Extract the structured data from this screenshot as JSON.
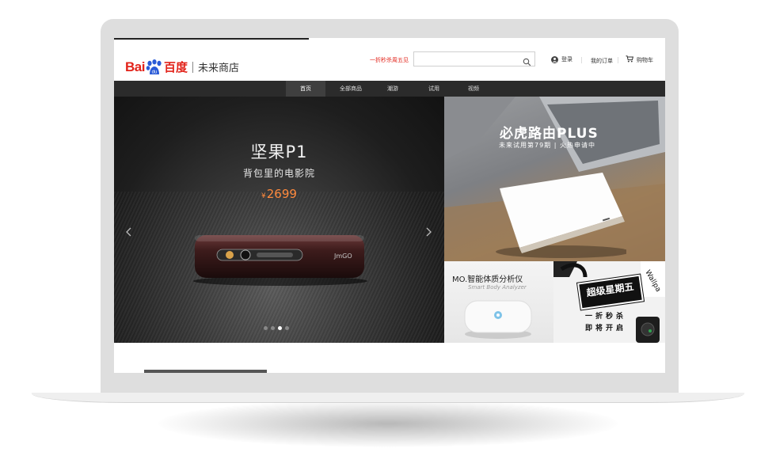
{
  "header": {
    "logo_bai": "Bai",
    "logo_du": "百度",
    "store_name": "未来商店",
    "promo_link": "一折秒杀周五见",
    "search_placeholder": "",
    "login_label": "登录",
    "orders_label": "我的订单",
    "cart_label": "购物车"
  },
  "nav": {
    "items": [
      {
        "label": "首页",
        "active": true
      },
      {
        "label": "全部商品",
        "active": false
      },
      {
        "label": "潮游",
        "active": false
      },
      {
        "label": "试用",
        "active": false
      },
      {
        "label": "视频",
        "active": false
      }
    ]
  },
  "hero": {
    "title": "坚果P1",
    "subtitle": "背包里的电影院",
    "currency": "¥",
    "price": "2699",
    "product_logo": "JmGO",
    "prev_icon": "chevron-left-icon",
    "next_icon": "chevron-right-icon",
    "slide_count": 4,
    "active_slide": 3
  },
  "side_promos": {
    "router": {
      "title": "必虎路由PLUS",
      "subtitle": "未来试用第79期 | 火热申请中"
    },
    "scale": {
      "title": "MO.智能体质分析仪",
      "subtitle": "Smart Body Analyzer"
    },
    "flash_sale": {
      "badge": "超级星期五",
      "line1": "一折秒杀",
      "line2": "即将开启"
    }
  },
  "colors": {
    "brand_red": "#e2231a",
    "nav_bg": "#2b2b2b",
    "price_orange": "#ff8a3d"
  }
}
